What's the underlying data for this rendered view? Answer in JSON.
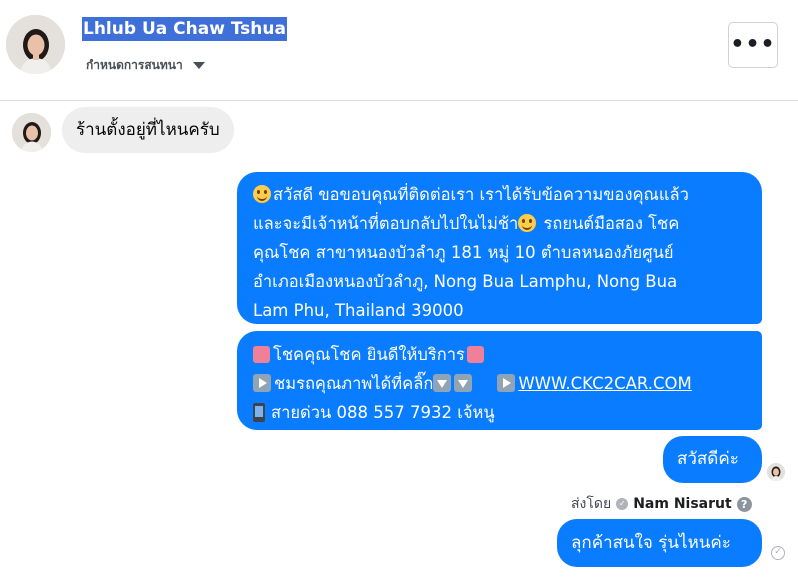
{
  "header": {
    "contact_name": "Lhlub Ua Chaw Tshua",
    "settings_label": "กำหนดการสนทนา",
    "more_label": "•••"
  },
  "messages": {
    "incoming_1": "ร้านตั้งอยู่ที่ไหนครับ",
    "auto_reply": {
      "line1": "สวัสดี ขอขอบคุณที่ติดต่อเรา เราได้รับข้อความของคุณแล้ว",
      "line2": "และจะมีเจ้าหน้าที่ตอบกลับไปในไม่ช้า",
      "line2_tail": " รถยนต์มือสอง โชค",
      "line3": "คุณโชค สาขาหนองบัวลำภู 181 หมู่ 10  ตำบลหนองภัยศูนย์",
      "line4": "อำเภอเมืองหนองบัวลำภู, Nong Bua Lamphu, Nong Bua",
      "line5": "Lam Phu, Thailand 39000"
    },
    "promo": {
      "line1": "โชคคุณโชค ยินดีให้บริการ",
      "line2": "ชมรถคุณภาพได้ที่คลิ๊ก",
      "link": "WWW.CKC2CAR.COM",
      "line3": "สายด่วน 088 557 7932 เจ้หนู"
    },
    "outgoing_greeting": "สวัสดีค่ะ",
    "sent_by_prefix": "ส่งโดย",
    "sent_by_name": "Nam Nisarut",
    "outgoing_question": "ลุกค้าสนใจ รุ่นไหนค่ะ"
  },
  "icons": {
    "avatar": "woman-avatar",
    "more": "more-dots-icon",
    "dropdown": "caret-down-icon",
    "smile": "smile-emoji",
    "laugh": "laugh-emoji",
    "sparkle": "sparkle-emoji",
    "play": "play-button-emoji",
    "down": "down-arrow-emoji",
    "phone": "mobile-phone-emoji",
    "verified": "check-icon",
    "help": "help-icon",
    "sent": "sent-check-icon"
  },
  "colors": {
    "outgoing_bubble": "#0a7cff",
    "incoming_bubble": "#eeeeee",
    "name_highlight": "#3f6fd8"
  }
}
